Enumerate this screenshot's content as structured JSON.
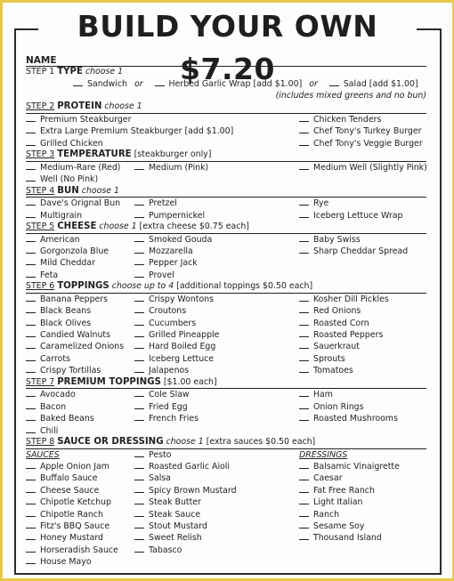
{
  "title": "BUILD YOUR OWN $7.20",
  "name_label": "NAME",
  "steps": {
    "s1": {
      "num": "STEP 1",
      "label": "TYPE",
      "note": "choose 1",
      "extra": "",
      "options": [
        "Sandwich",
        "Herbed Garlic Wrap [add $1.00]",
        "Salad [add $1.00]"
      ],
      "or": "or",
      "salad_note": "(includes mixed greens and no bun)"
    },
    "s2": {
      "num": "STEP 2",
      "label": "PROTEIN",
      "note": "choose 1",
      "extra": "",
      "col1": [
        "Premium Steakburger",
        "Extra Large Premium Steakburger [add $1.00]",
        "Grilled Chicken"
      ],
      "col3": [
        "Chicken Tenders",
        "Chef Tony's Turkey Burger",
        "Chef Tony's Veggie Burger"
      ]
    },
    "s3": {
      "num": "STEP 3",
      "label": "TEMPERATURE",
      "note": "",
      "extra": "[steakburger only]",
      "col1": [
        "Medium-Rare (Red)",
        "Well (No Pink)"
      ],
      "col2": [
        "Medium (Pink)"
      ],
      "col3": [
        "Medium Well (Slightly Pink)"
      ]
    },
    "s4": {
      "num": "STEP 4",
      "label": "BUN",
      "note": "choose 1",
      "extra": "",
      "col1": [
        "Dave's Orignal Bun",
        "Multigrain"
      ],
      "col2": [
        "Pretzel",
        "Pumpernickel"
      ],
      "col3": [
        "Rye",
        "Iceberg Lettuce Wrap"
      ]
    },
    "s5": {
      "num": "STEP 5",
      "label": "CHEESE",
      "note": "choose 1",
      "extra": "[extra cheese $0.75 each]",
      "col1": [
        "American",
        "Gorgonzola Blue",
        "Mild Cheddar",
        "Feta"
      ],
      "col2": [
        "Smoked Gouda",
        "Mozzarella",
        "Pepper Jack",
        "Provel"
      ],
      "col3": [
        "Baby Swiss",
        "Sharp Cheddar Spread"
      ]
    },
    "s6": {
      "num": "STEP 6",
      "label": "TOPPINGS",
      "note": "choose up to 4",
      "extra": "[additional toppings $0.50 each]",
      "col1": [
        "Banana Peppers",
        "Black Beans",
        "Black Olives",
        "Candied Walnuts",
        "Caramelized Onions",
        "Carrots",
        "Crispy Tortillas"
      ],
      "col2": [
        "Crispy Wontons",
        "Croutons",
        "Cucumbers",
        "Grilled Pineapple",
        "Hard Boiled Egg",
        "Iceberg Lettuce",
        "Jalapenos"
      ],
      "col3": [
        "Kosher Dill Pickles",
        "Red Onions",
        "Roasted Corn",
        "Roasted Peppers",
        "Sauerkraut",
        "Sprouts",
        "Tomatoes"
      ]
    },
    "s7": {
      "num": "STEP 7",
      "label": "PREMIUM TOPPINGS",
      "note": "",
      "extra": "[$1.00 each]",
      "col1": [
        "Avocado",
        "Bacon",
        "Baked Beans",
        "Chili"
      ],
      "col2": [
        "Cole Slaw",
        "Fried Egg",
        "French Fries"
      ],
      "col3": [
        "Ham",
        "Onion Rings",
        "Roasted Mushrooms"
      ]
    },
    "s8": {
      "num": "STEP 8",
      "label": "SAUCE OR DRESSING",
      "note": "choose 1",
      "extra": "[extra sauces $0.50 each]",
      "sauces_heading": "SAUCES",
      "dressings_heading": "DRESSINGS",
      "col1": [
        "Apple Onion Jam",
        "Buffalo Sauce",
        "Cheese Sauce",
        "Chipotle Ketchup",
        "Chipotle Ranch",
        "Fitz's BBQ Sauce",
        "Honey Mustard",
        "Horseradish Sauce",
        "House Mayo"
      ],
      "col2": [
        "Pesto",
        "Roasted Garlic Aioli",
        "Salsa",
        "Spicy Brown Mustard",
        "Steak Butter",
        "Steak Sauce",
        "Stout Mustard",
        "Sweet Relish",
        "Tabasco"
      ],
      "col3": [
        "Balsamic Vinaigrette",
        "Caesar",
        "Fat Free Ranch",
        "Light Italian",
        "Ranch",
        "Sesame Soy",
        "Thousand Island"
      ]
    }
  }
}
